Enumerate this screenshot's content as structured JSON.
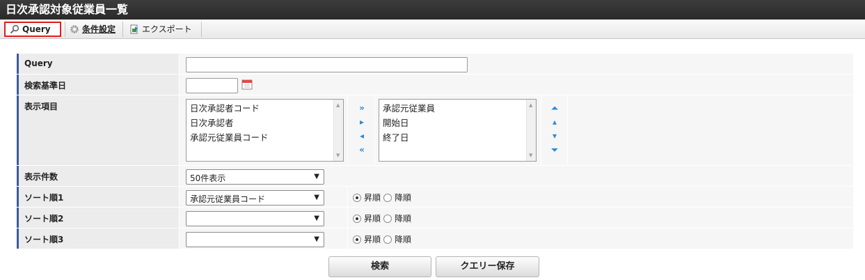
{
  "window": {
    "title": "日次承認対象従業員一覧"
  },
  "toolbar": {
    "query_label": "Query",
    "conditions_label": "条件設定",
    "export_label": "エクスポート"
  },
  "form": {
    "query": {
      "label": "Query",
      "value": ""
    },
    "base_date": {
      "label": "検索基準日",
      "value": ""
    },
    "display_items": {
      "label": "表示項目",
      "available": [
        "日次承認者コード",
        "日次承認者",
        "承認元従業員コード"
      ],
      "selected": [
        "承認元従業員",
        "開始日",
        "終了日"
      ]
    },
    "count": {
      "label": "表示件数",
      "value": "50件表示"
    },
    "sort1": {
      "label": "ソート順1",
      "value": "承認元従業員コード",
      "asc": "昇順",
      "desc": "降順",
      "selected": "asc"
    },
    "sort2": {
      "label": "ソート順2",
      "value": "",
      "asc": "昇順",
      "desc": "降順",
      "selected": "asc"
    },
    "sort3": {
      "label": "ソート順3",
      "value": "",
      "asc": "昇順",
      "desc": "降順",
      "selected": "asc"
    }
  },
  "buttons": {
    "search": "検索",
    "save_query": "クエリー保存"
  },
  "colors": {
    "accent_border": "#3b5b9a",
    "active_outline": "#e01d1d",
    "arrow_blue": "#2e8ad8"
  }
}
